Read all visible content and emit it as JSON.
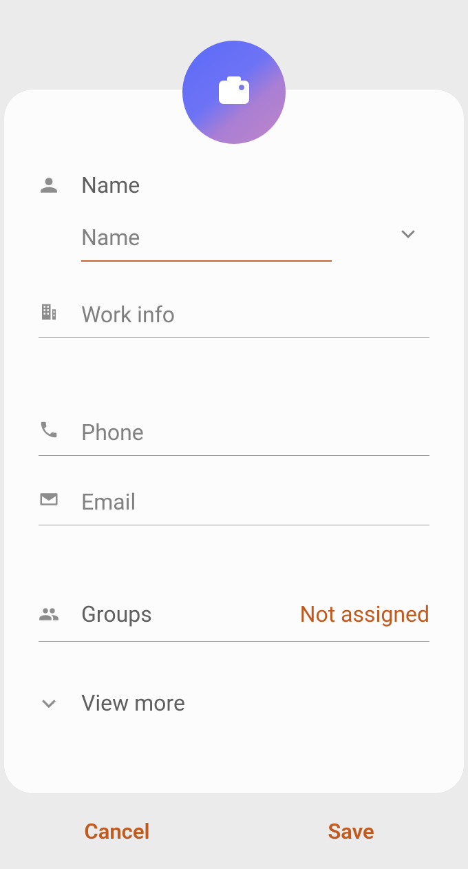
{
  "colors": {
    "accent": "#c15a1f",
    "underline_active": "#c56631"
  },
  "avatar": {
    "icon": "camera-icon"
  },
  "fields": {
    "name": {
      "label": "Name",
      "placeholder": "Name",
      "value": ""
    },
    "work_info": {
      "label": "Work info",
      "value": ""
    },
    "phone": {
      "label": "Phone",
      "value": ""
    },
    "email": {
      "label": "Email",
      "value": ""
    },
    "groups": {
      "label": "Groups",
      "value": "Not assigned"
    }
  },
  "view_more": {
    "label": "View more"
  },
  "footer": {
    "cancel": "Cancel",
    "save": "Save"
  }
}
